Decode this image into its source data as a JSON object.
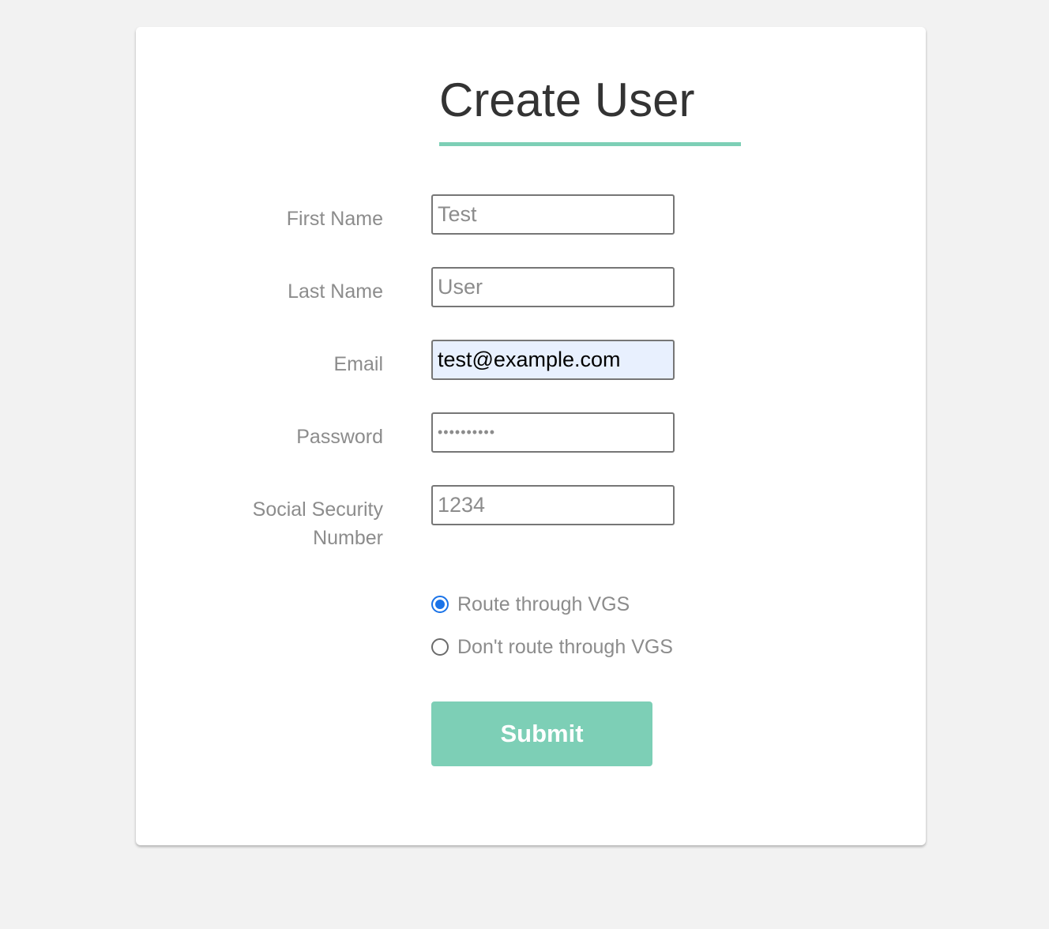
{
  "form": {
    "title": "Create User",
    "accent_color": "#7dcfb6",
    "fields": {
      "first_name": {
        "label": "First Name",
        "placeholder": "Test",
        "value": ""
      },
      "last_name": {
        "label": "Last Name",
        "placeholder": "User",
        "value": ""
      },
      "email": {
        "label": "Email",
        "placeholder": "",
        "value": "test@example.com"
      },
      "password": {
        "label": "Password",
        "placeholder": "",
        "value": "••••••••••"
      },
      "ssn": {
        "label_line1": "Social Security",
        "label_line2": "Number",
        "placeholder": "1234",
        "value": ""
      }
    },
    "routing": {
      "selected": "route",
      "options": [
        {
          "label": "Route through VGS",
          "checked": true
        },
        {
          "label": "Don't route through VGS",
          "checked": false
        }
      ]
    },
    "submit_label": "Submit"
  }
}
